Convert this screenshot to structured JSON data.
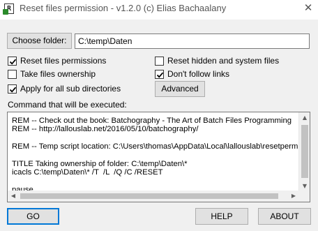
{
  "window": {
    "icon_letter": "R",
    "title": "Reset files permission - v1.2.0 (c) Elias Bachaalany",
    "close_glyph": "✕"
  },
  "folder": {
    "button_label": "Choose folder:",
    "value": "C:\\temp\\Daten"
  },
  "options": {
    "reset_permissions": {
      "label": "Reset files permissions",
      "checked": true
    },
    "take_ownership": {
      "label": "Take files ownership",
      "checked": false
    },
    "sub_directories": {
      "label": "Apply for all sub directories",
      "checked": true
    },
    "reset_hidden_system": {
      "label": "Reset hidden and system files",
      "checked": false
    },
    "dont_follow_links": {
      "label": "Don't follow links",
      "checked": true
    }
  },
  "advanced_label": "Advanced",
  "command": {
    "heading": "Command that will be executed:",
    "lines": [
      "REM -- Check out the book: Batchography - The Art of Batch Files Programming",
      "REM -- http://lallouslab.net/2016/05/10/batchography/",
      "",
      "REM -- Temp script location: C:\\Users\\thomas\\AppData\\Local\\lallouslab\\resetperm.ba",
      "",
      "TITLE Taking ownership of folder: C:\\temp\\Daten\\*",
      "icacls C:\\temp\\Daten\\* /T  /L  /Q /C /RESET",
      "",
      "pause"
    ]
  },
  "buttons": {
    "go": "GO",
    "help": "HELP",
    "about": "ABOUT"
  },
  "colors": {
    "window_bg": "#f0f0f0",
    "default_button_border": "#0078d7"
  },
  "icons": {
    "scroll_up": "up-arrow-icon",
    "scroll_down": "down-arrow-icon",
    "scroll_left": "left-arrow-icon",
    "scroll_right": "right-arrow-icon"
  }
}
